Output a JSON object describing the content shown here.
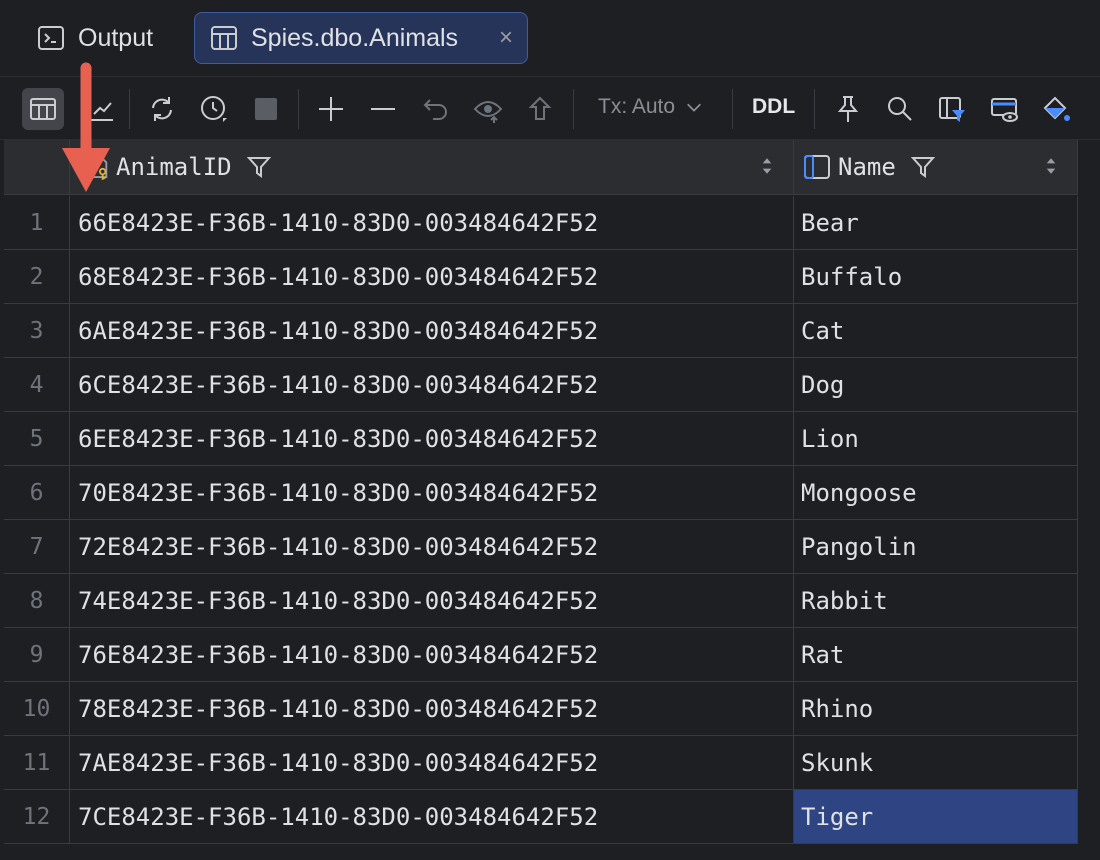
{
  "tabs": {
    "output_label": "Output",
    "active_label": "Spies.dbo.Animals",
    "close_glyph": "×"
  },
  "toolbar": {
    "icons": [
      "table-view-icon",
      "chart-view-icon",
      "refresh-icon",
      "history-icon",
      "stop-icon",
      "add-row-icon",
      "delete-row-icon",
      "revert-icon",
      "preview-icon",
      "submit-icon",
      "pin-icon",
      "search-icon",
      "filter-view-icon",
      "view-editor-icon",
      "paint-icon"
    ],
    "tx_label": "Tx: Auto",
    "ddl_label": "DDL"
  },
  "grid": {
    "columns": [
      {
        "label": "AnimalID",
        "icon": "primary-key-icon"
      },
      {
        "label": "Name",
        "icon": "column-icon"
      }
    ],
    "rows": [
      {
        "n": "1",
        "id": "66E8423E-F36B-1410-83D0-003484642F52",
        "name": "Bear"
      },
      {
        "n": "2",
        "id": "68E8423E-F36B-1410-83D0-003484642F52",
        "name": "Buffalo"
      },
      {
        "n": "3",
        "id": "6AE8423E-F36B-1410-83D0-003484642F52",
        "name": "Cat"
      },
      {
        "n": "4",
        "id": "6CE8423E-F36B-1410-83D0-003484642F52",
        "name": "Dog"
      },
      {
        "n": "5",
        "id": "6EE8423E-F36B-1410-83D0-003484642F52",
        "name": "Lion"
      },
      {
        "n": "6",
        "id": "70E8423E-F36B-1410-83D0-003484642F52",
        "name": "Mongoose"
      },
      {
        "n": "7",
        "id": "72E8423E-F36B-1410-83D0-003484642F52",
        "name": "Pangolin"
      },
      {
        "n": "8",
        "id": "74E8423E-F36B-1410-83D0-003484642F52",
        "name": "Rabbit"
      },
      {
        "n": "9",
        "id": "76E8423E-F36B-1410-83D0-003484642F52",
        "name": "Rat"
      },
      {
        "n": "10",
        "id": "78E8423E-F36B-1410-83D0-003484642F52",
        "name": "Rhino"
      },
      {
        "n": "11",
        "id": "7AE8423E-F36B-1410-83D0-003484642F52",
        "name": "Skunk"
      },
      {
        "n": "12",
        "id": "7CE8423E-F36B-1410-83D0-003484642F52",
        "name": "Tiger"
      }
    ],
    "selected_cell": {
      "row": 12,
      "column": "Name"
    }
  },
  "colors": {
    "background": "#1e1f22",
    "header_bg": "#2b2d30",
    "active_tab_bg": "#26345a",
    "selection": "#2e4483",
    "annotation_arrow": "#e8604f"
  }
}
